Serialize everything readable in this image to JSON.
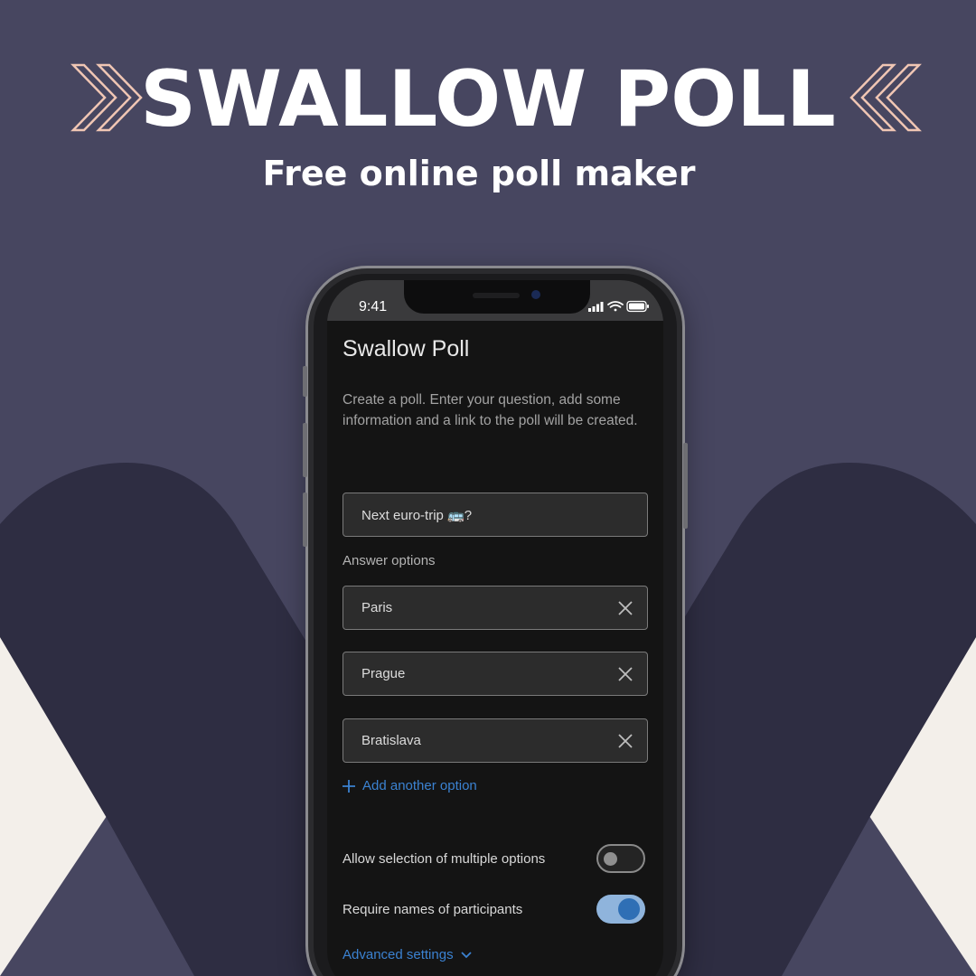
{
  "banner": {
    "title": "SWALLOW POLL",
    "subtitle": "Free online poll maker",
    "left_icon": "double-chevron-right-icon",
    "right_icon": "double-chevron-left-icon"
  },
  "colors": {
    "background": "#474660",
    "background_shape": "#2e2d42",
    "corner_fill": "#f3efea",
    "chevron_stroke": "#f0c6b4",
    "accent": "#3b82d1",
    "screen": "#141414"
  },
  "status_bar": {
    "time": "9:41",
    "icons": [
      "signal-icon",
      "wifi-icon",
      "battery-icon"
    ]
  },
  "app": {
    "title": "Swallow Poll",
    "description": "Create a poll. Enter your question, add some information and a link to the poll will be created.",
    "question": {
      "value": "Next euro-trip 🚌?"
    },
    "answer_options_label": "Answer options",
    "options": [
      {
        "value": "Paris",
        "clear_icon": "close-icon"
      },
      {
        "value": "Prague",
        "clear_icon": "close-icon"
      },
      {
        "value": "Bratislava",
        "clear_icon": "close-icon"
      }
    ],
    "add_option_label": "Add another option",
    "toggles": [
      {
        "label": "Allow selection of multiple options",
        "on": false
      },
      {
        "label": "Require names of participants",
        "on": true
      }
    ],
    "advanced_label": "Advanced settings"
  }
}
